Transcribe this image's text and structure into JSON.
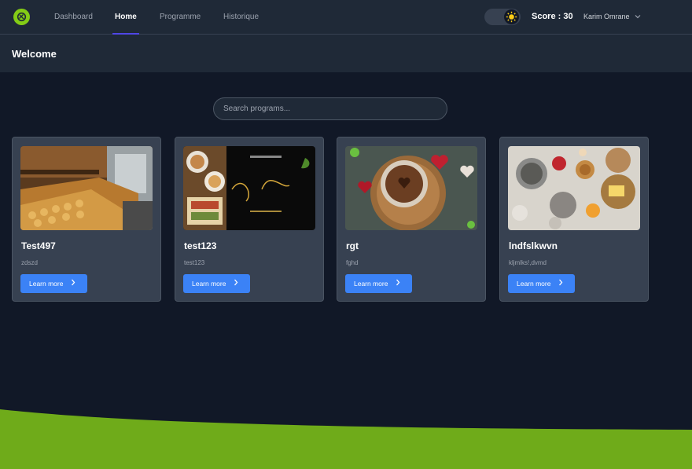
{
  "nav": {
    "links": [
      {
        "label": "Dashboard"
      },
      {
        "label": "Home"
      },
      {
        "label": "Programme"
      },
      {
        "label": "Historique"
      }
    ],
    "score_label": "Score : 30",
    "user_name": "Karim Omrane"
  },
  "welcome": {
    "title": "Welcome"
  },
  "search": {
    "placeholder": "Search programs..."
  },
  "cards": [
    {
      "title": "Test497",
      "description": "zdszd",
      "button": "Learn more",
      "image": "bakery-display-photo"
    },
    {
      "title": "test123",
      "description": "test123",
      "button": "Learn more",
      "image": "bon-achat-voucher-photo"
    },
    {
      "title": "rgt",
      "description": "fghd",
      "button": "Learn more",
      "image": "chocolate-drink-photo"
    },
    {
      "title": "lndfslkwvn",
      "description": "kljmlks!,dvmd",
      "button": "Learn more",
      "image": "breakfast-table-photo"
    }
  ],
  "colors": {
    "accent": "#3b82f6",
    "brand": "#84cc16",
    "active_underline": "#4f46e5",
    "wave": "#6fab1a"
  }
}
